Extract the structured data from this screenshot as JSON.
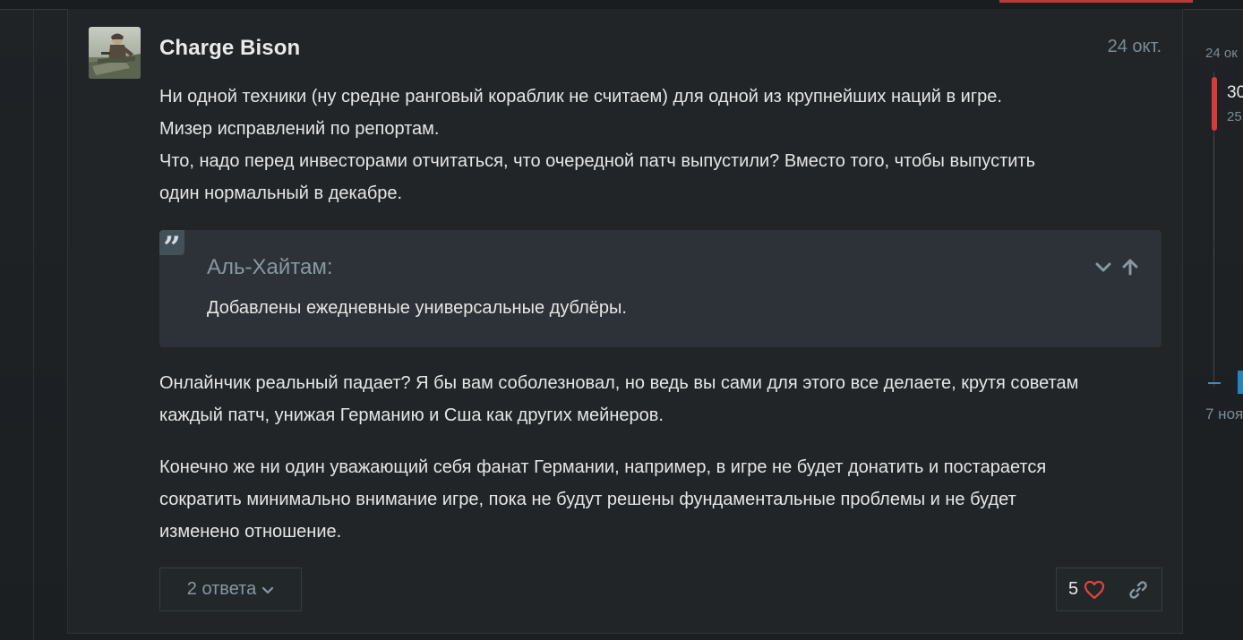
{
  "post": {
    "username": "Charge Bison",
    "date": "24 окт.",
    "avatar_icon": "pilot-avatar",
    "paragraphs": {
      "p1": [
        "Ни одной техники (ну средне ранговый кораблик не считаем) для одной из крупнейших наций в игре.",
        "Мизер исправлений по репортам.",
        "Что, надо перед инвесторами отчитаться, что очередной патч выпустили? Вместо того, чтобы выпустить",
        "один нормальный в декабре."
      ],
      "p2": [
        "Онлайнчик реальный падает? Я бы вам соболезновал, но ведь вы сами для этого все делаете, крутя советам",
        "каждый патч, унижая Германию и Сша как других мейнеров."
      ],
      "p3": [
        "Конечно же ни один уважающий себя фанат Германии, например, в игре не будет донатить и постарается",
        "сократить минимально внимание игре, пока не будут решены фундаментальные проблемы и не будет",
        "изменено отношение."
      ]
    },
    "quote": {
      "mark": "”",
      "author": "Аль-Хайтам:",
      "text": "Добавлены ежедневные универсальные дублёры.",
      "expand_icon": "chevron-down-icon",
      "jump_icon": "arrow-up-icon"
    },
    "replies_label": "2 ответа",
    "likes": "5",
    "like_icon": "heart-icon",
    "link_icon": "link-icon"
  },
  "timeline": {
    "start_date": "24 ок",
    "position": "30",
    "position_sub": "25",
    "end_date": "7 ноя",
    "progress": 0.0
  },
  "colors": {
    "accent_red": "#d43b3b",
    "accent_blue": "#1f86c2",
    "background": "#212528",
    "quote_bg": "#2c3237",
    "muted_text": "#7d8b94"
  }
}
